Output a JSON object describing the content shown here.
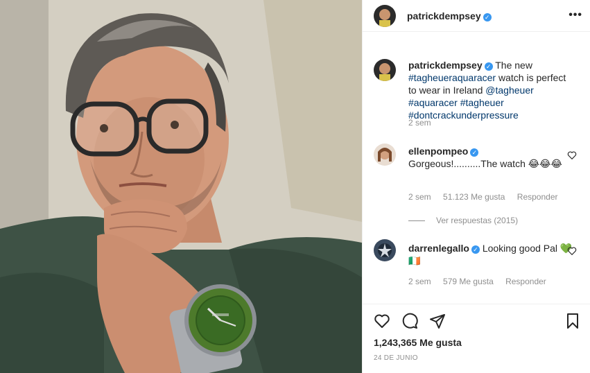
{
  "post": {
    "author": "patrickdempsey",
    "menu_icon": "more-dots-icon",
    "caption": {
      "username": "patrickdempsey",
      "text_1": "The new",
      "tag_1": "#tagheueraquaracer",
      "text_2": "watch is perfect to wear in Ireland",
      "tag_2": "@tagheuer",
      "tag_3": "#aquaracer",
      "tag_4": "#tagheuer",
      "tag_5": "#dontcrackunderpressure",
      "time": "2 sem"
    },
    "comments": [
      {
        "username": "ellenpompeo",
        "text": "Gorgeous!..........The watch 😂😂😂",
        "time": "2 sem",
        "likes": "51.123 Me gusta",
        "reply": "Responder",
        "view_replies": "Ver respuestas (2015)"
      },
      {
        "username": "darrenlegallo",
        "text": "Looking good Pal 💚🇮🇪",
        "time": "2 sem",
        "likes": "579 Me gusta",
        "reply": "Responder"
      }
    ],
    "likes_count": "1,243,365 Me gusta",
    "date": "24 DE JUNIO",
    "icons": {
      "like": "heart-icon",
      "comment": "comment-icon",
      "share": "share-icon",
      "save": "bookmark-icon"
    },
    "colors": {
      "verified": "#3897f0",
      "hashtag": "#00376b",
      "muted": "#8e8e8e"
    }
  }
}
